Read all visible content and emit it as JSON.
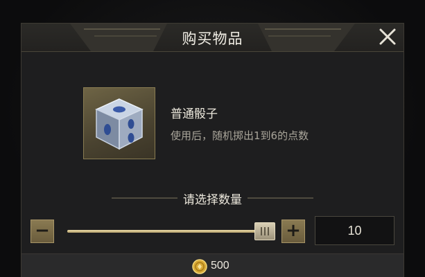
{
  "dialog": {
    "title": "购买物品"
  },
  "item": {
    "icon": "dice-icon",
    "name": "普通骰子",
    "description": "使用后，随机掷出1到6的点数"
  },
  "quantity": {
    "section_title": "请选择数量",
    "decrease_symbol": "−",
    "increase_symbol": "+",
    "value": "10",
    "slider_level": 0.95
  },
  "footer": {
    "currency_icon": "gold-coin-icon",
    "price": "500"
  },
  "colors": {
    "accent_gold": "#b9a56e",
    "panel": "#1e1e1f"
  }
}
